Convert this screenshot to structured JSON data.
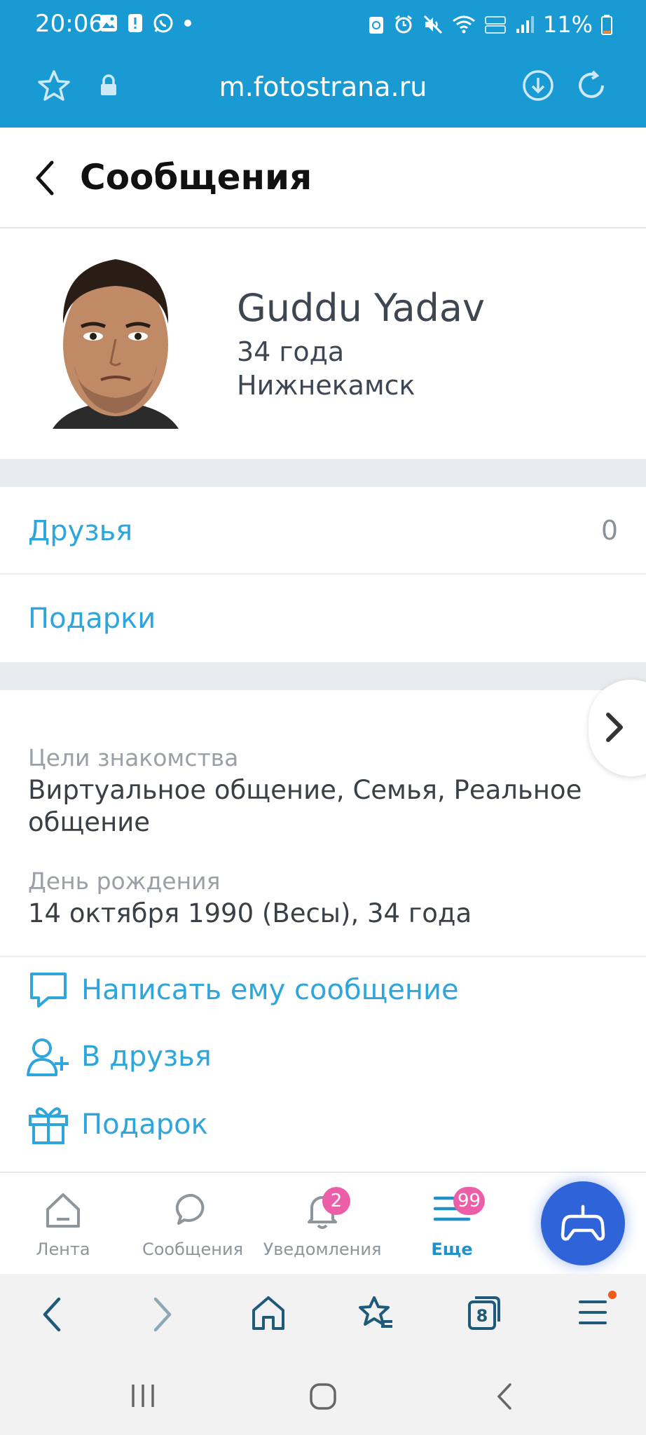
{
  "status_bar": {
    "time": "20:06",
    "battery": "11%"
  },
  "url_bar": {
    "url": "m.fotostrana.ru"
  },
  "header": {
    "title": "Сообщения"
  },
  "profile": {
    "name": "Guddu Yadav",
    "age": "34 года",
    "city": "Нижнекамск"
  },
  "links": [
    {
      "label": "Друзья",
      "count": "0"
    },
    {
      "label": "Подарки",
      "count": ""
    }
  ],
  "info": [
    {
      "key": "Цели знакомства",
      "value": "Виртуальное общение, Семья, Реальное общение"
    },
    {
      "key": "День рождения",
      "value": "14 октября 1990 (Весы), 34 года"
    }
  ],
  "actions": [
    {
      "label": "Написать ему сообщение",
      "icon": "chat-bubble-icon"
    },
    {
      "label": "В друзья",
      "icon": "add-friend-icon"
    },
    {
      "label": "Подарок",
      "icon": "gift-icon"
    }
  ],
  "bottom_nav": {
    "items": [
      {
        "label": "Лента",
        "icon": "feed-icon",
        "badge": ""
      },
      {
        "label": "Сообщения",
        "icon": "message-icon",
        "badge": ""
      },
      {
        "label": "Уведомления",
        "icon": "bell-icon",
        "badge": "2"
      },
      {
        "label": "Еще",
        "icon": "menu-icon",
        "badge": "99"
      }
    ]
  },
  "browser_toolbar": {
    "tabs_count": "8"
  },
  "colors": {
    "top_bar": "#1a9ad3",
    "link": "#2ea6dc",
    "badge": "#ec5fa8",
    "fab": "#2f63d8"
  }
}
